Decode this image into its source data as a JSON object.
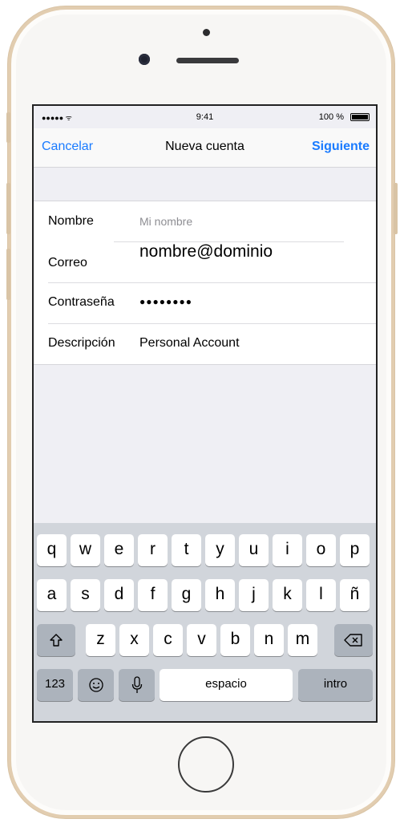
{
  "status_bar": {
    "signal": "●●●●● ᯤ",
    "time": "9:41",
    "battery": "100 %"
  },
  "navbar": {
    "cancel": "Cancelar",
    "title": "Nueva cuenta",
    "next": "Siguiente"
  },
  "form": {
    "name_label": "Nombre",
    "name_placeholder": "Mi nombre",
    "email_label": "Correo",
    "email_value": "nombre@dominio",
    "password_label": "Contraseña",
    "password_value": "●●●●●●●●",
    "description_label": "Descripción",
    "description_value": "Personal Account"
  },
  "keyboard": {
    "row1": [
      "q",
      "w",
      "e",
      "r",
      "t",
      "y",
      "u",
      "i",
      "o",
      "p"
    ],
    "row2": [
      "a",
      "s",
      "d",
      "f",
      "g",
      "h",
      "j",
      "k",
      "l",
      "ñ"
    ],
    "row3": [
      "z",
      "x",
      "c",
      "v",
      "b",
      "n",
      "m"
    ],
    "numbers_key": "123",
    "space_key": "espacio",
    "return_key": "intro"
  },
  "icons": {
    "shift": "shift-icon",
    "delete": "delete-icon",
    "emoji": "emoji-icon",
    "mic": "microphone-icon"
  }
}
